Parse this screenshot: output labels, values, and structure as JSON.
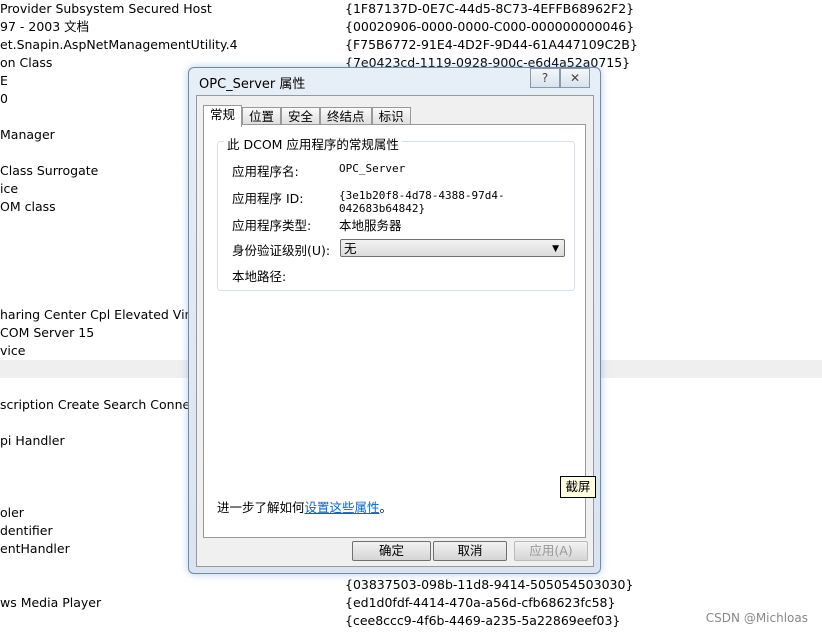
{
  "background_list": [
    {
      "name": "Provider Subsystem Secured Host",
      "guid": "{1F87137D-0E7C-44d5-8C73-4EFFB68962F2}"
    },
    {
      "name": " 97 - 2003 文档",
      "guid": "{00020906-0000-0000-C000-000000000046}"
    },
    {
      "name": "et.Snapin.AspNetManagementUtility.4",
      "guid": "{F75B6772-91E4-4D2F-9D44-61A447109C2B}"
    },
    {
      "name": "on Class",
      "guid": "{7e0423cd-1119-0928-900c-e6d4a52a0715}"
    },
    {
      "name": "E",
      "guid": ""
    },
    {
      "name": "0",
      "guid": ""
    },
    {
      "name": "",
      "guid": ""
    },
    {
      "name": "Manager",
      "guid": ""
    },
    {
      "name": "",
      "guid": ""
    },
    {
      "name": "Class Surrogate",
      "guid": ""
    },
    {
      "name": "ice",
      "guid": ""
    },
    {
      "name": "OM class",
      "guid": ""
    },
    {
      "name": "",
      "guid": ""
    },
    {
      "name": "",
      "guid": ""
    },
    {
      "name": "",
      "guid": ""
    },
    {
      "name": "",
      "guid": ""
    },
    {
      "name": "",
      "guid": ""
    },
    {
      "name": "haring Center Cpl Elevated Virtual",
      "guid": ""
    },
    {
      "name": " COM Server 15",
      "guid": ""
    },
    {
      "name": "vice",
      "guid": ""
    },
    {
      "name": "",
      "guid": "",
      "selected": true
    },
    {
      "name": "",
      "guid": ""
    },
    {
      "name": "scription Create Search Connector",
      "guid": ""
    },
    {
      "name": "",
      "guid": ""
    },
    {
      "name": "pi Handler",
      "guid": ""
    },
    {
      "name": "",
      "guid": ""
    },
    {
      "name": "",
      "guid": ""
    },
    {
      "name": "",
      "guid": ""
    },
    {
      "name": "oler",
      "guid": ""
    },
    {
      "name": "dentifier",
      "guid": ""
    },
    {
      "name": "entHandler",
      "guid": ""
    },
    {
      "name": "",
      "guid": ""
    },
    {
      "name": "",
      "guid": "{03837503-098b-11d8-9414-505054503030}"
    },
    {
      "name": "ws Media Player",
      "guid": "{ed1d0fdf-4414-470a-a56d-cfb68623fc58}"
    },
    {
      "name": "",
      "guid": "{cee8ccc9-4f6b-4469-a235-5a22869eef03}"
    }
  ],
  "dialog": {
    "title": "OPC_Server 属性",
    "help": "?",
    "close": "✕",
    "tabs": [
      "常规",
      "位置",
      "安全",
      "终结点",
      "标识"
    ],
    "group_title": "此 DCOM 应用程序的常规属性",
    "fields": {
      "app_name_label": "应用程序名:",
      "app_name": "OPC_Server",
      "app_id_label": "应用程序 ID:",
      "app_id": "{3e1b20f8-4d78-4388-97d4-042683b64842}",
      "app_type_label": "应用程序类型:",
      "app_type": "本地服务器",
      "auth_label": "身份验证级别(U):",
      "auth_value": "无",
      "path_label": "本地路径:"
    },
    "learn_prefix": "进一步了解如何",
    "learn_link": "设置这些属性",
    "learn_suffix": "。",
    "tooltip": "截屏",
    "ok": "确定",
    "cancel": "取消",
    "apply": "应用(A)"
  },
  "watermark": "CSDN @Michloas"
}
